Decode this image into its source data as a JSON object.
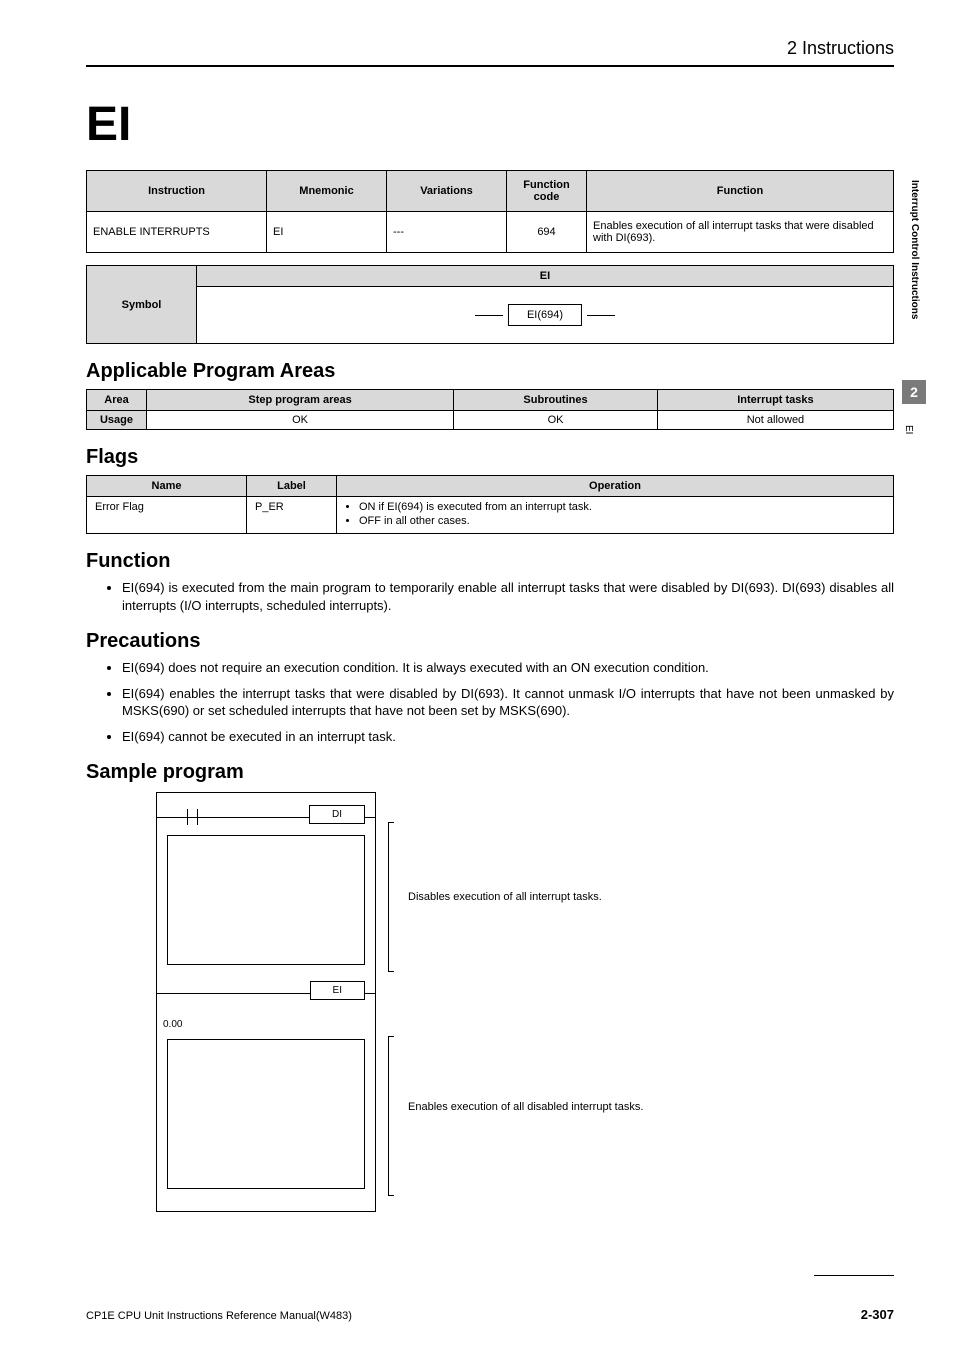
{
  "breadcrumb": "2   Instructions",
  "title": "EI",
  "side": {
    "vertical_label": "Interrupt Control Instructions",
    "section_number": "2",
    "side_ei": "EI"
  },
  "instr_table": {
    "headers": {
      "instruction": "Instruction",
      "mnemonic": "Mnemonic",
      "variations": "Variations",
      "func_code": "Function code",
      "function": "Function"
    },
    "row": {
      "instruction": "ENABLE INTERRUPTS",
      "mnemonic": "EI",
      "variations": "---",
      "func_code": "694",
      "function": "Enables execution of all interrupt tasks that were disabled with DI(693)."
    }
  },
  "symbol": {
    "row_label": "Symbol",
    "col_label": "EI",
    "box_text": "EI(694)"
  },
  "applicable_heading": "Applicable Program Areas",
  "area_table": {
    "headers": {
      "area": "Area",
      "step": "Step program areas",
      "sub": "Subroutines",
      "intr": "Interrupt tasks"
    },
    "row": {
      "label": "Usage",
      "step": "OK",
      "sub": "OK",
      "intr": "Not allowed"
    }
  },
  "flags_heading": "Flags",
  "flags_table": {
    "headers": {
      "name": "Name",
      "label": "Label",
      "operation": "Operation"
    },
    "row": {
      "name": "Error Flag",
      "label": "P_ER",
      "op1": "ON if EI(694) is executed from an interrupt task.",
      "op2": "OFF in all other cases."
    }
  },
  "function_heading": "Function",
  "function_items": [
    "EI(694) is executed from the main program to temporarily enable all interrupt tasks that were disabled by DI(693). DI(693) disables all interrupts (I/O interrupts, scheduled interrupts)."
  ],
  "precautions_heading": "Precautions",
  "precautions_items": [
    "EI(694) does not require an execution condition. It is always executed with an ON execution condition.",
    "EI(694) enables the interrupt tasks that were disabled by DI(693). It cannot unmask I/O interrupts that have not been unmasked by MSKS(690) or set scheduled interrupts that have not been set by MSKS(690).",
    "EI(694) cannot be executed in an interrupt task."
  ],
  "sample_heading": "Sample program",
  "diagram": {
    "di_label": "DI",
    "ei_label": "EI",
    "zero": "0.00",
    "caption1": "Disables execution of all interrupt tasks.",
    "caption2": "Enables execution of all disabled interrupt tasks."
  },
  "footer": {
    "manual": "CP1E CPU Unit Instructions Reference Manual(W483)",
    "page": "2-307"
  }
}
